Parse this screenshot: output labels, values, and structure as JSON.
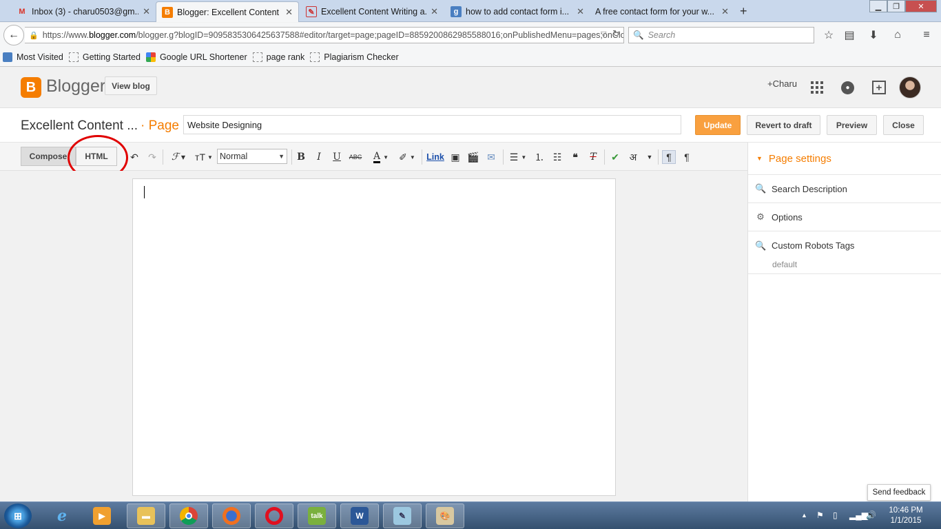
{
  "browser": {
    "tabs": [
      {
        "title": "Inbox (3) - charu0503@gm...",
        "icon": "gmail-icon"
      },
      {
        "title": "Blogger: Excellent Content ...",
        "icon": "blogger-icon",
        "active": true
      },
      {
        "title": "Excellent Content Writing a...",
        "icon": "site-icon"
      },
      {
        "title": "how to add contact form i...",
        "icon": "google-icon"
      },
      {
        "title": "A free contact form for your w...",
        "icon": "none"
      }
    ],
    "url_prefix": "https://www.",
    "url_domain": "blogger.com",
    "url_rest": "/blogger.g?blogID=9095835306425637588#editor/target=page;pageID=8859200862985588016;onPublishedMenu=pages;onClos",
    "search_placeholder": "Search",
    "bookmarks": [
      "Most Visited",
      "Getting Started",
      "Google URL Shortener",
      "page rank",
      "Plagiarism Checker"
    ]
  },
  "header": {
    "app_name": "Blogger",
    "view_blog_label": "View blog",
    "user_label": "+Charu"
  },
  "titlebar": {
    "blog_title": "Excellent Content ...",
    "page_label": "· Page",
    "page_title_value": "Website Designing",
    "update_label": "Update",
    "revert_label": "Revert to draft",
    "preview_label": "Preview",
    "close_label": "Close"
  },
  "toolbar": {
    "compose_label": "Compose",
    "html_label": "HTML",
    "font_size_value": "Normal",
    "link_label": "Link"
  },
  "sidebar": {
    "heading": "Page settings",
    "items": [
      {
        "label": "Search Description",
        "icon": "search-icon"
      },
      {
        "label": "Options",
        "icon": "gear-icon"
      },
      {
        "label": "Custom Robots Tags",
        "icon": "search-icon",
        "sub": "default"
      }
    ]
  },
  "feedback_label": "Send feedback",
  "taskbar": {
    "time": "10:46 PM",
    "date": "1/1/2015"
  },
  "colors": {
    "accent": "#f57d00",
    "update_button": "#f9a03f",
    "annotation_circle": "#e00000"
  }
}
